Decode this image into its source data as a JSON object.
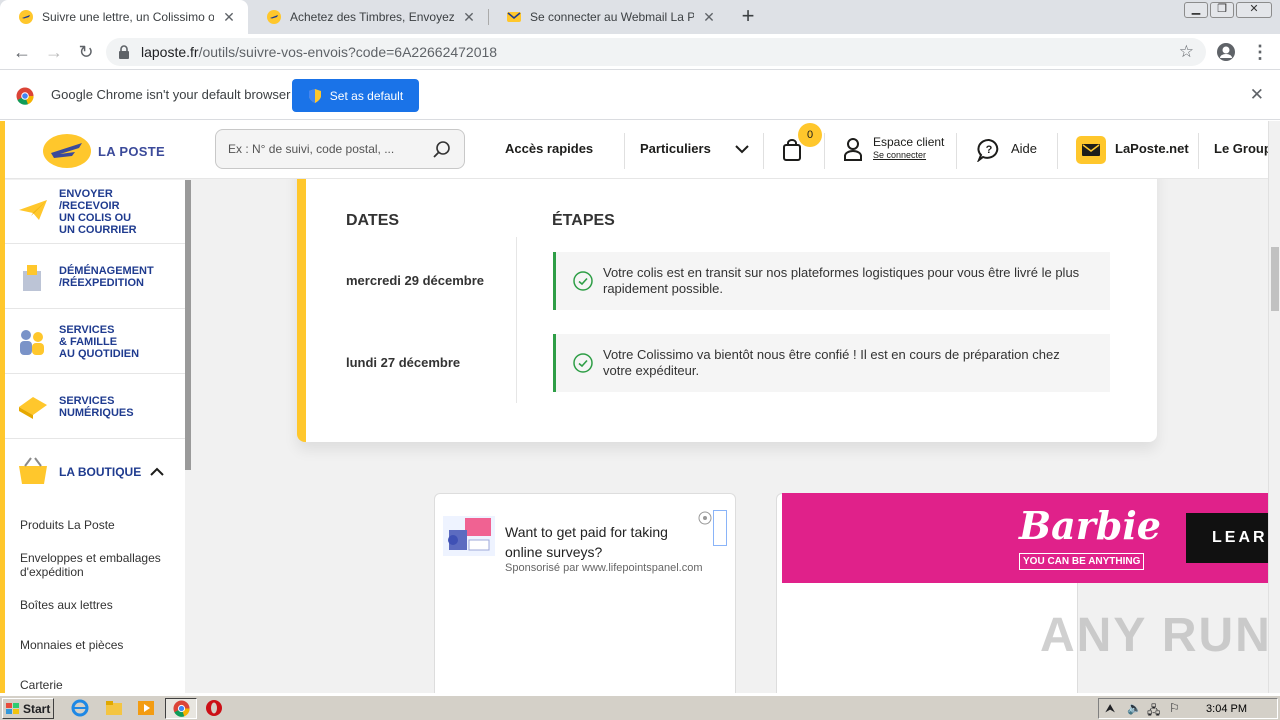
{
  "browser": {
    "tabs": [
      {
        "title": "Suivre une lettre, un Colissimo ou un",
        "active": true
      },
      {
        "title": "Achetez des Timbres, Envoyez Cour",
        "active": false
      },
      {
        "title": "Se connecter au Webmail La Poste -",
        "active": false
      }
    ],
    "new_tab_label": "+",
    "url_host": "laposte.fr",
    "url_path": "/outils/suivre-vos-envois?code=6A22662472018",
    "infobar": {
      "message": "Google Chrome isn't your default browser",
      "button": "Set as default"
    }
  },
  "site": {
    "logo_text": "LA POSTE",
    "search_placeholder": "Ex : N° de suivi, code postal, ...",
    "nav": {
      "acces_rapides": "Accès rapides",
      "particuliers": "Particuliers",
      "cart_count": "0",
      "espace_client": "Espace client",
      "se_connecter": "Se connecter",
      "aide": "Aide",
      "laposte_net": "LaPoste.net",
      "le_groupe": "Le Group"
    },
    "left_menu": [
      {
        "label": "ENVOYER\n/RECEVOIR\nUN COLIS OU\nUN COURRIER",
        "icon": "plane-icon"
      },
      {
        "label": "DÉMÉNAGEMENT\n/RÉEXPEDITION",
        "icon": "mailbox-icon"
      },
      {
        "label": "SERVICES\n& FAMILLE\nAU QUOTIDIEN",
        "icon": "family-icon"
      },
      {
        "label": "SERVICES\nNUMÉRIQUES",
        "icon": "digital-icon"
      },
      {
        "label": "LA BOUTIQUE",
        "icon": "shop-icon"
      }
    ],
    "boutique_items": [
      "Produits La Poste",
      "Enveloppes et emballages\nd'expédition",
      "Boîtes aux lettres",
      "Monnaies et pièces",
      "Carterie"
    ]
  },
  "tracking": {
    "dates_header": "DATES",
    "steps_header": "ÉTAPES",
    "events": [
      {
        "date": "mercredi 29 décembre",
        "text": "Votre colis est en transit sur nos plateformes logistiques pour vous être livré le plus rapidement possible."
      },
      {
        "date": "lundi 27 décembre",
        "text": "Votre Colissimo va bientôt nous être confié ! Il est en cours de préparation chez votre expéditeur."
      }
    ]
  },
  "ads": {
    "survey_title": "Want to get paid for taking online surveys?",
    "survey_sponsor": "Sponsorisé par www.lifepointspanel.com",
    "barbie_logo": "Barbie",
    "barbie_tagline": "YOU CAN BE ANYTHING",
    "barbie_cta": "LEAR"
  },
  "watermark": "ANY RUN",
  "taskbar": {
    "start": "Start",
    "clock": "3:04 PM"
  },
  "colors": {
    "laposte_yellow": "#ffc72c",
    "laposte_blue": "#1f3b8f",
    "step_green": "#2e9e46",
    "chrome_blue": "#1a73e8",
    "barbie_pink": "#e0218a"
  }
}
